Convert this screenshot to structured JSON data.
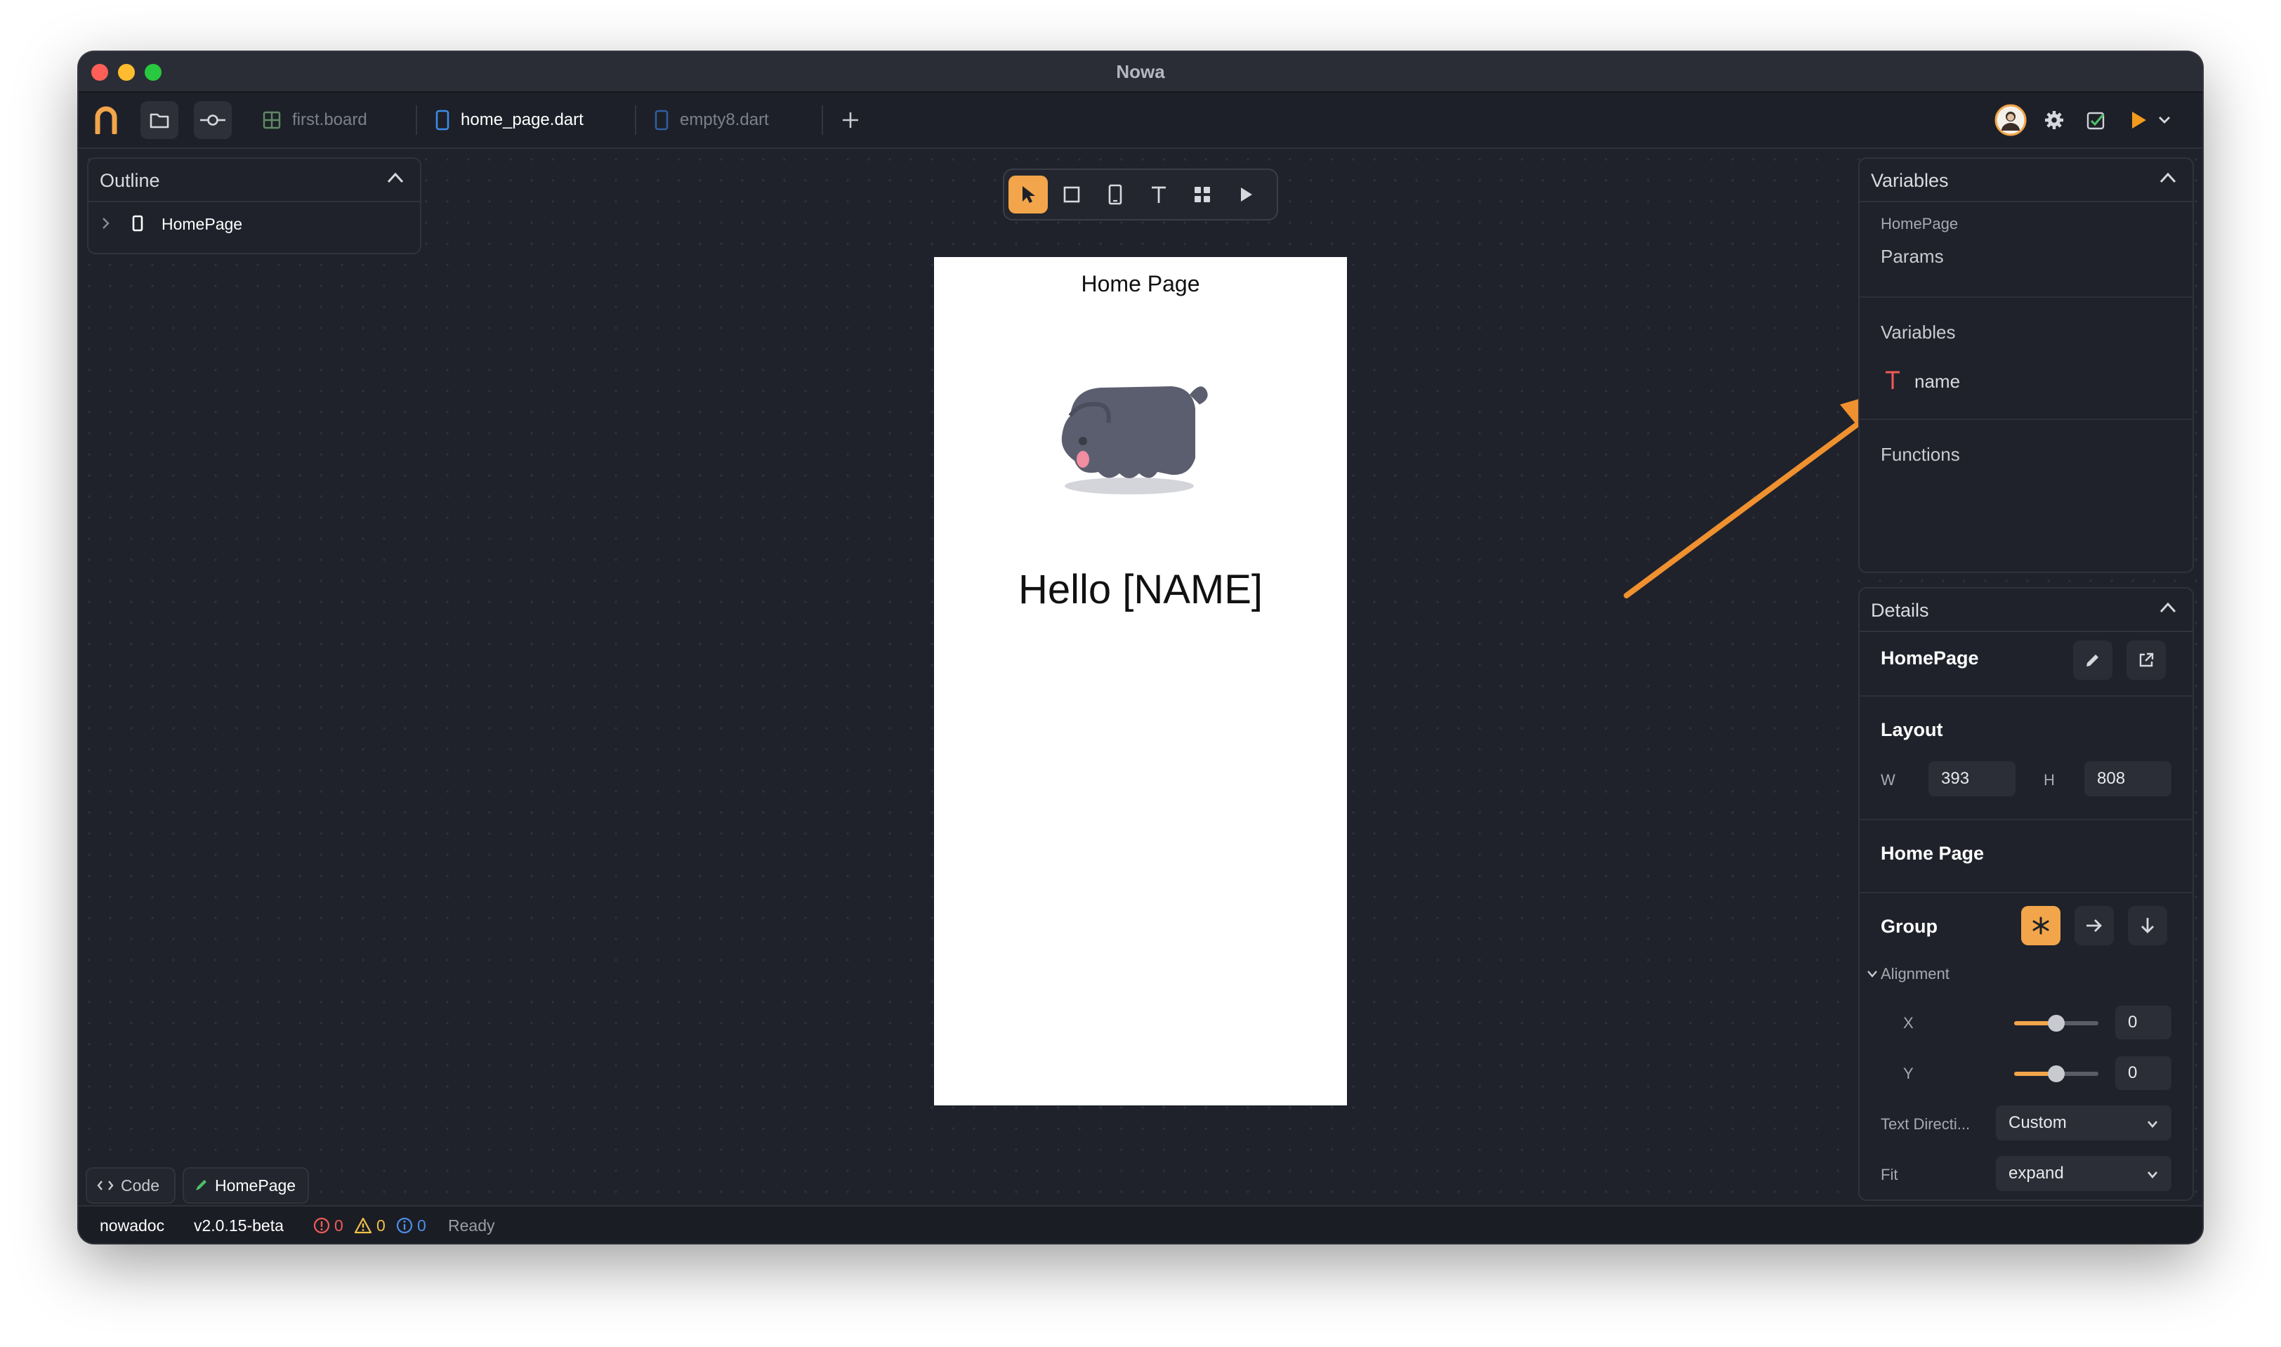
{
  "window": {
    "title": "Nowa"
  },
  "tabs": [
    {
      "label": "first.board"
    },
    {
      "label": "home_page.dart"
    },
    {
      "label": "empty8.dart"
    }
  ],
  "outline": {
    "title": "Outline",
    "items": [
      {
        "label": "HomePage"
      }
    ]
  },
  "canvas_toolbar": {
    "tools": [
      "select-arrow-icon",
      "rectangle-icon",
      "phone-frame-icon",
      "text-icon",
      "components-icon",
      "play-icon"
    ],
    "active_tool": "select-arrow-icon"
  },
  "phone": {
    "app_bar_title": "Home Page",
    "greeting": "Hello [NAME]"
  },
  "variables_panel": {
    "title": "Variables",
    "page_name": "HomePage",
    "params_label": "Params",
    "variables_label": "Variables",
    "variables": [
      {
        "type_icon": "text-type-icon",
        "name": "name"
      }
    ],
    "functions_label": "Functions"
  },
  "details_panel": {
    "title": "Details",
    "component_name": "HomePage",
    "layout": {
      "label": "Layout",
      "w_label": "W",
      "w_value": "393",
      "h_label": "H",
      "h_value": "808"
    },
    "page_title_label": "Home Page",
    "group": {
      "label": "Group",
      "modes": [
        "asterisk-icon",
        "arrow-right-icon",
        "arrow-down-icon"
      ],
      "active_mode": "asterisk-icon"
    },
    "alignment": {
      "label": "Alignment",
      "x_label": "X",
      "x_value": "0",
      "x_slider": 0.5,
      "y_label": "Y",
      "y_value": "0",
      "y_slider": 0.5
    },
    "text_direction": {
      "label": "Text Directi...",
      "value": "Custom"
    },
    "fit": {
      "label": "Fit",
      "value": "expand"
    }
  },
  "bottom_tabs": {
    "code_label": "Code",
    "page_label": "HomePage"
  },
  "status_bar": {
    "project": "nowadoc",
    "version": "v2.0.15-beta",
    "errors": "0",
    "warnings": "0",
    "infos": "0",
    "status": "Ready"
  },
  "colors": {
    "accent": "#f2a54a",
    "background": "#1f222b",
    "panel": "#1f222a",
    "annotation_arrow": "#f0912f"
  }
}
